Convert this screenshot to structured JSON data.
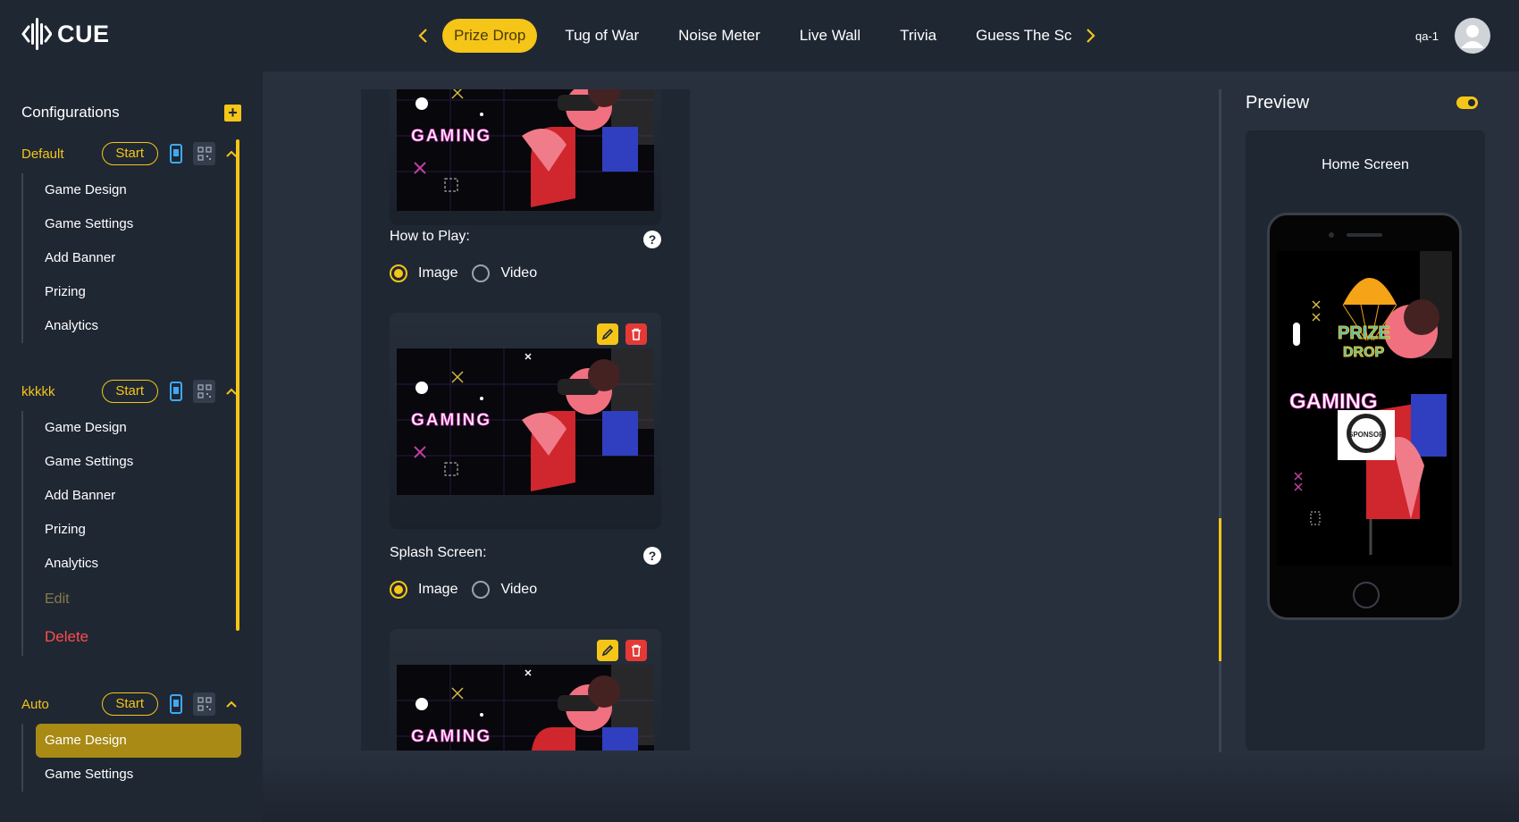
{
  "app": {
    "logo_text": "CUE"
  },
  "nav": {
    "tabs": [
      {
        "label": "Prize Drop",
        "active": true
      },
      {
        "label": "Tug of War",
        "active": false
      },
      {
        "label": "Noise Meter",
        "active": false
      },
      {
        "label": "Live Wall",
        "active": false
      },
      {
        "label": "Trivia",
        "active": false
      },
      {
        "label": "Guess The Sc",
        "active": false
      }
    ]
  },
  "user": {
    "name": "qa-1"
  },
  "sidebar": {
    "title": "Configurations",
    "groups": [
      {
        "name": "Default",
        "start_label": "Start",
        "items": [
          "Game Design",
          "Game Settings",
          "Add Banner",
          "Prizing",
          "Analytics"
        ]
      },
      {
        "name": "kkkkk",
        "start_label": "Start",
        "items": [
          "Game Design",
          "Game Settings",
          "Add Banner",
          "Prizing",
          "Analytics"
        ],
        "edit_label": "Edit",
        "delete_label": "Delete"
      },
      {
        "name": "Auto",
        "start_label": "Start",
        "items": [
          "Game Design",
          "Game Settings"
        ],
        "active_item": "Game Design"
      }
    ]
  },
  "form": {
    "how_to_play": {
      "label": "How to Play:",
      "options": [
        "Image",
        "Video"
      ],
      "selected": "Image"
    },
    "splash_screen": {
      "label": "Splash Screen:",
      "options": [
        "Image",
        "Video"
      ],
      "selected": "Image"
    },
    "help_glyph": "?",
    "thumbnail_text": "GAMING"
  },
  "preview": {
    "title": "Preview",
    "screen_label": "Home Screen",
    "game_logo_top": "PRIZE",
    "game_logo_bottom": "DROP",
    "sponsor_text": "SPONSOR",
    "thumbnail_text": "GAMING"
  },
  "colors": {
    "accent": "#f5c518",
    "danger": "#e53935",
    "bg": "#1f2733",
    "main_bg": "#28303e"
  }
}
